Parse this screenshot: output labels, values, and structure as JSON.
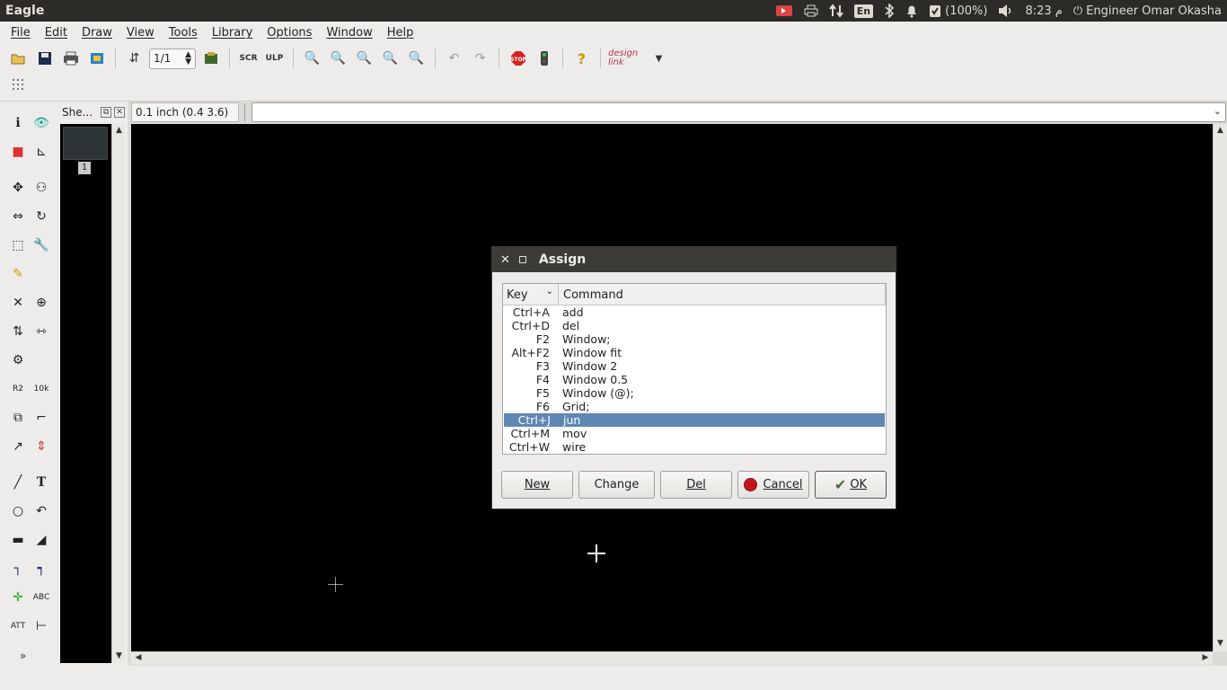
{
  "window": {
    "app_title": "Eagle"
  },
  "indicators": {
    "language": "En",
    "battery": "(100%)",
    "clock": "8:23 م",
    "user": "Engineer Omar Okasha"
  },
  "menu": [
    "File",
    "Edit",
    "Draw",
    "View",
    "Tools",
    "Library",
    "Options",
    "Window",
    "Help"
  ],
  "toolbar": {
    "page_value": "1/1",
    "design_link": "design link"
  },
  "sheets": {
    "title": "She...",
    "sheet_number": "1"
  },
  "coordinates": "0.1 inch (0.4 3.6)",
  "command_line": {
    "value": ""
  },
  "dialog": {
    "title": "Assign",
    "columns": {
      "key": "Key",
      "command": "Command"
    },
    "rows": [
      {
        "key": "Ctrl+A",
        "command": "add"
      },
      {
        "key": "Ctrl+D",
        "command": "del"
      },
      {
        "key": "F2",
        "command": "Window;"
      },
      {
        "key": "Alt+F2",
        "command": "Window fit"
      },
      {
        "key": "F3",
        "command": "Window 2"
      },
      {
        "key": "F4",
        "command": "Window 0.5"
      },
      {
        "key": "F5",
        "command": "Window (@);"
      },
      {
        "key": "F6",
        "command": "Grid;"
      },
      {
        "key": "Ctrl+J",
        "command": "jun"
      },
      {
        "key": "Ctrl+M",
        "command": "mov"
      },
      {
        "key": "Ctrl+W",
        "command": "wire"
      }
    ],
    "selected_row": 8,
    "buttons": {
      "new": "New",
      "change": "Change",
      "del": "Del",
      "cancel": "Cancel",
      "ok": "OK"
    }
  }
}
